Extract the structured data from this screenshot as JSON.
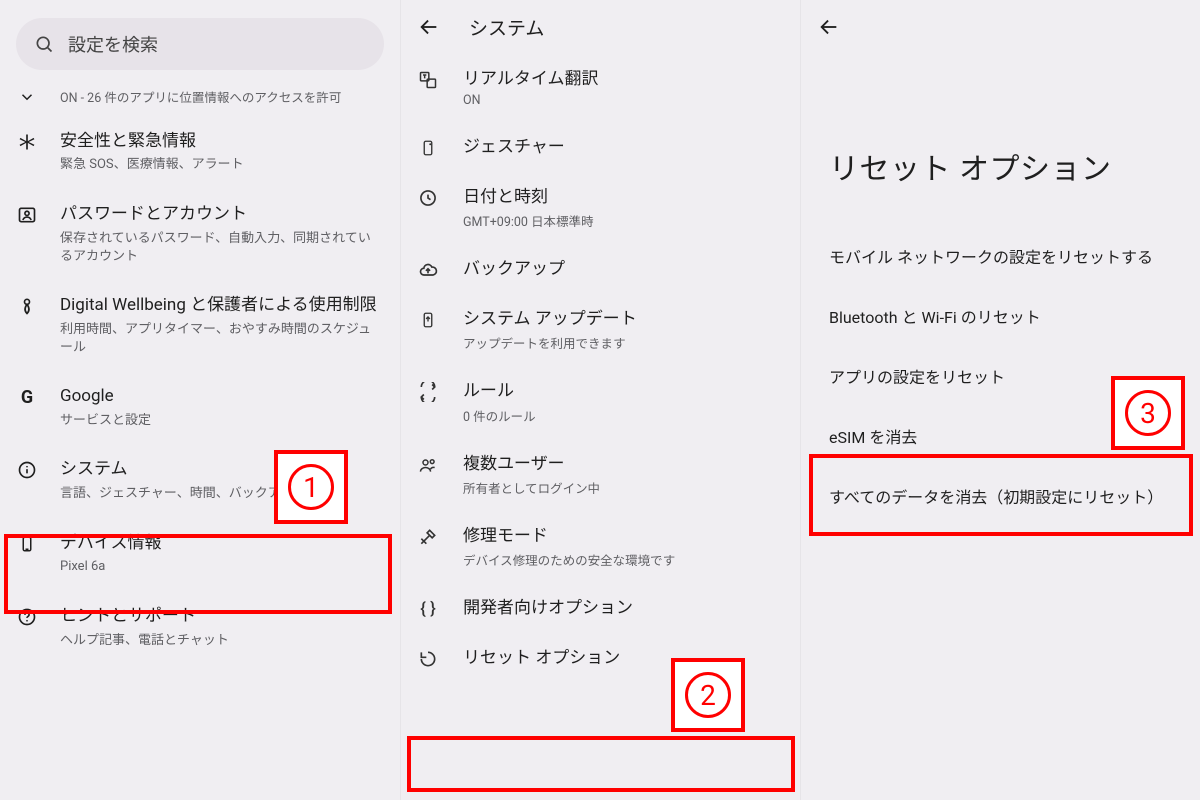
{
  "pane1": {
    "search_placeholder": "設定を検索",
    "collapsed": {
      "sub": "ON - 26 件のアプリに位置情報へのアクセスを許可"
    },
    "rows": [
      {
        "icon": "asterisk",
        "title": "安全性と緊急情報",
        "sub": "緊急 SOS、医療情報、アラート"
      },
      {
        "icon": "account",
        "title": "パスワードとアカウント",
        "sub": "保存されているパスワード、自動入力、同期されているアカウント"
      },
      {
        "icon": "wellbeing",
        "title": "Digital Wellbeing と保護者による使用制限",
        "sub": "利用時間、アプリタイマー、おやすみ時間のスケジュール"
      },
      {
        "icon": "google",
        "title": "Google",
        "sub": "サービスと設定"
      },
      {
        "icon": "info",
        "title": "システム",
        "sub": "言語、ジェスチャー、時間、バックアップ"
      },
      {
        "icon": "phone",
        "title": "デバイス情報",
        "sub": "Pixel 6a"
      },
      {
        "icon": "help",
        "title": "ヒントとサポート",
        "sub": "ヘルプ記事、電話とチャット"
      }
    ]
  },
  "pane2": {
    "header": "システム",
    "rows": [
      {
        "icon": "translate",
        "title": "リアルタイム翻訳",
        "sub": "ON"
      },
      {
        "icon": "gesture",
        "title": "ジェスチャー",
        "sub": ""
      },
      {
        "icon": "clock",
        "title": "日付と時刻",
        "sub": "GMT+09:00 日本標準時"
      },
      {
        "icon": "cloud",
        "title": "バックアップ",
        "sub": ""
      },
      {
        "icon": "update",
        "title": "システム アップデート",
        "sub": "アップデートを利用できます"
      },
      {
        "icon": "rules",
        "title": "ルール",
        "sub": "0 件のルール"
      },
      {
        "icon": "users",
        "title": "複数ユーザー",
        "sub": "所有者としてログイン中"
      },
      {
        "icon": "repair",
        "title": "修理モード",
        "sub": "デバイス修理のための安全な環境です"
      },
      {
        "icon": "braces",
        "title": "開発者向けオプション",
        "sub": ""
      },
      {
        "icon": "reset",
        "title": "リセット オプション",
        "sub": ""
      }
    ]
  },
  "pane3": {
    "title": "リセット オプション",
    "items": [
      "モバイル ネットワークの設定をリセットする",
      "Bluetooth と Wi-Fi のリセット",
      "アプリの設定をリセット",
      "eSIM を消去",
      "すべてのデータを消去（初期設定にリセット）"
    ]
  },
  "callouts": {
    "1": "1",
    "2": "2",
    "3": "3"
  }
}
